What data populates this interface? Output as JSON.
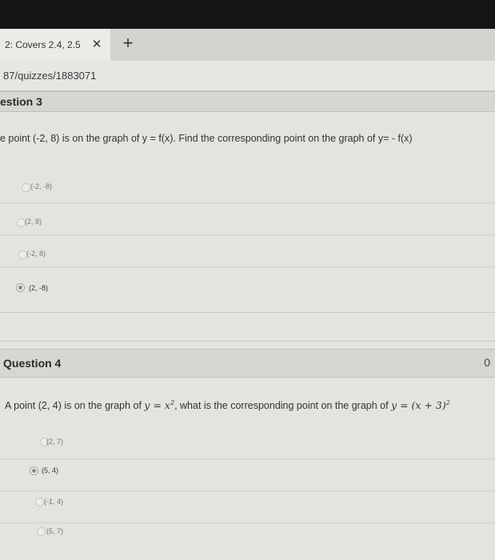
{
  "browser": {
    "tab_title": "2: Covers 2.4, 2.5",
    "close_glyph": "✕",
    "new_tab_glyph": "+",
    "url": "87/quizzes/1883071"
  },
  "question3": {
    "title": "estion 3",
    "text": "e point (-2, 8) is on the graph of y = f(x). Find the corresponding point on the graph of y= - f(x)",
    "answers": [
      {
        "label": "(-2, -8)",
        "selected": false
      },
      {
        "label": "(2, 8)",
        "selected": false
      },
      {
        "label": "(-2, 8)",
        "selected": false
      },
      {
        "label": "(2, -8)",
        "selected": true
      }
    ]
  },
  "question4": {
    "title": "Question 4",
    "points": "0",
    "text_before": "A point (2, 4) is on the graph of ",
    "math1": "y = x",
    "math1_exp": "2",
    "text_middle": ", what is the corresponding point on the graph of ",
    "math2": "y = (x + 3)",
    "math2_exp": "2",
    "answers": [
      {
        "label": "(2, 7)",
        "selected": false
      },
      {
        "label": "(5, 4)",
        "selected": true
      },
      {
        "label": "(-1, 4)",
        "selected": false
      },
      {
        "label": "(5, 7)",
        "selected": false
      }
    ]
  }
}
